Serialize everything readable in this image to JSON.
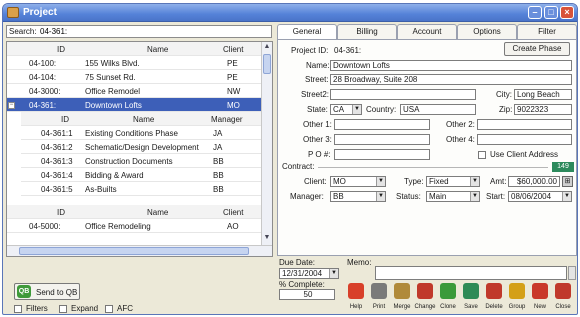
{
  "window": {
    "title": "Project"
  },
  "search": {
    "label": "Search:",
    "value": "04-361:"
  },
  "projects_table": {
    "headers": [
      "ID",
      "Name",
      "Client"
    ],
    "rows": [
      {
        "id": "04-100:",
        "name": "155 Wilks Blvd.",
        "client": "PE"
      },
      {
        "id": "04-104:",
        "name": "75 Sunset Rd.",
        "client": "PE"
      },
      {
        "id": "04-3000:",
        "name": "Office Remodel",
        "client": "NW"
      },
      {
        "id": "04-361:",
        "name": "Downtown Lofts",
        "client": "MO"
      }
    ],
    "sub_headers": [
      "ID",
      "Name",
      "Manager"
    ],
    "sub_rows": [
      {
        "id": "04-361:1",
        "name": "Existing Conditions Phase",
        "manager": "JA"
      },
      {
        "id": "04-361:2",
        "name": "Schematic/Design Development",
        "manager": "JA"
      },
      {
        "id": "04-361:3",
        "name": "Construction Documents",
        "manager": "BB"
      },
      {
        "id": "04-361:4",
        "name": "Bidding & Award",
        "manager": "BB"
      },
      {
        "id": "04-361:5",
        "name": "As-Builts",
        "manager": "BB"
      }
    ],
    "footer_headers": [
      "ID",
      "Name",
      "Client"
    ],
    "footer_rows": [
      {
        "id": "04-5000:",
        "name": "Office Remodeling",
        "client": "AO"
      }
    ]
  },
  "send_qb": {
    "label": "Send to QB",
    "icon": "qb-icon"
  },
  "filters": [
    {
      "label": "Filters",
      "checked": false
    },
    {
      "label": "Expand",
      "checked": false
    },
    {
      "label": "AFC",
      "checked": false
    }
  ],
  "tabs": [
    {
      "label": "General",
      "active": true
    },
    {
      "label": "Billing",
      "active": false
    },
    {
      "label": "Account",
      "active": false
    },
    {
      "label": "Options",
      "active": false
    },
    {
      "label": "Filter",
      "active": false
    }
  ],
  "general": {
    "project_id_label": "Project ID:",
    "project_id": "04-361:",
    "create_phase": "Create Phase",
    "name_label": "Name:",
    "name": "Downtown Lofts",
    "street_label": "Street:",
    "street": "28 Broadway, Suite 208",
    "street2_label": "Street2:",
    "street2": "",
    "city_label": "City:",
    "city": "Long Beach",
    "state_label": "State:",
    "state": "CA",
    "country_label": "Country:",
    "country": "USA",
    "zip_label": "Zip:",
    "zip": "9022323",
    "other1_label": "Other 1:",
    "other2_label": "Other 2:",
    "other3_label": "Other 3:",
    "other4_label": "Other 4:",
    "po_label": "P O #:",
    "use_client_address": "Use Client Address",
    "contract_label": "Contract:",
    "contract_value": "149",
    "client_label": "Client:",
    "client": "MO",
    "type_label": "Type:",
    "type": "Fixed",
    "amt_label": "Amt:",
    "amt": "$60,000.00",
    "manager_label": "Manager:",
    "manager": "BB",
    "status_label": "Status:",
    "status": "Main",
    "start_label": "Start:",
    "start": "08/06/2004"
  },
  "bottom": {
    "due_date_label": "Due Date:",
    "due_date": "12/31/2004",
    "memo_label": "Memo:",
    "complete_label": "% Complete:",
    "complete_value": "50"
  },
  "toolbar": [
    {
      "label": "Help",
      "icon": "help-icon",
      "color": "#d8402a"
    },
    {
      "label": "Print",
      "icon": "print-icon",
      "color": "#7a7a7a"
    },
    {
      "label": "Merge",
      "icon": "merge-icon",
      "color": "#b08a3a"
    },
    {
      "label": "Change",
      "icon": "change-icon",
      "color": "#c0392b"
    },
    {
      "label": "Clone",
      "icon": "clone-icon",
      "color": "#3a9a3a"
    },
    {
      "label": "Save",
      "icon": "save-icon",
      "color": "#2e8b57"
    },
    {
      "label": "Delete",
      "icon": "delete-icon",
      "color": "#c0392b"
    },
    {
      "label": "Group",
      "icon": "group-icon",
      "color": "#d4a017"
    },
    {
      "label": "New",
      "icon": "new-icon",
      "color": "#c9382a"
    },
    {
      "label": "Close",
      "icon": "close-icon",
      "color": "#c0392b"
    }
  ],
  "colors": {
    "selected_row": "#3d5fb8",
    "title_bar": "#5582d8",
    "contract_badge": "#2c8a5c"
  }
}
